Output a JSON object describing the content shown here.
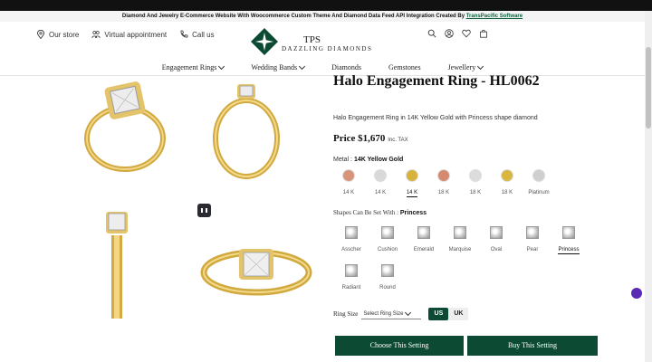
{
  "promo": {
    "text": "Diamond And Jewelry E-Commerce Website With Woocommerce Custom Theme And Diamond Data Feed API Integration Created By ",
    "link": "TransPacific Software"
  },
  "header": {
    "store": "Our store",
    "appointment": "Virtual appointment",
    "call": "Call us",
    "logo_tps": "TPS",
    "logo_name": "DAZZLING DIAMONDS"
  },
  "nav": [
    {
      "label": "Engagement Rings",
      "dropdown": true
    },
    {
      "label": "Wedding Bands",
      "dropdown": true
    },
    {
      "label": "Diamonds",
      "dropdown": false
    },
    {
      "label": "Gemstones",
      "dropdown": false
    },
    {
      "label": "Jewellery",
      "dropdown": true
    }
  ],
  "product": {
    "title": "Halo Engagement Ring - HL0062",
    "description": "Halo Engagement Ring in 14K Yellow Gold with Princess shape diamond",
    "price_label": "Price $1,670",
    "price_tax": "Inc. TAX",
    "metal_prefix": "Metal :",
    "metal_value": "14K Yellow Gold",
    "metals": [
      {
        "label": "14 K",
        "color": "#d89478",
        "selected": false
      },
      {
        "label": "14 K",
        "color": "#d9d9d9",
        "selected": false
      },
      {
        "label": "14 K",
        "color": "#d8b33c",
        "selected": true
      },
      {
        "label": "18 K",
        "color": "#d58a70",
        "selected": false
      },
      {
        "label": "18 K",
        "color": "#dcdcdc",
        "selected": false
      },
      {
        "label": "18 K",
        "color": "#d9b63e",
        "selected": false
      },
      {
        "label": "Platinum",
        "color": "#cfcfcf",
        "selected": false
      }
    ],
    "shape_prefix": "Shapes Can Be Set With :",
    "shape_value": "Princess",
    "shapes": [
      {
        "label": "Asscher",
        "selected": false
      },
      {
        "label": "Cushion",
        "selected": false
      },
      {
        "label": "Emerald",
        "selected": false
      },
      {
        "label": "Marquise",
        "selected": false
      },
      {
        "label": "Oval",
        "selected": false
      },
      {
        "label": "Pear",
        "selected": false
      },
      {
        "label": "Princess",
        "selected": true
      },
      {
        "label": "Radiant",
        "selected": false
      },
      {
        "label": "Round",
        "selected": false
      }
    ],
    "ring_size_label": "Ring Size",
    "ring_size_placeholder": "Select Ring Size",
    "units": [
      {
        "label": "US",
        "active": true
      },
      {
        "label": "UK",
        "active": false
      }
    ],
    "cta_setting": "Choose This Setting",
    "cta_buy": "Buy This Setting"
  },
  "colors": {
    "brand_green": "#0d4a33",
    "gold": "#d8b33c"
  }
}
